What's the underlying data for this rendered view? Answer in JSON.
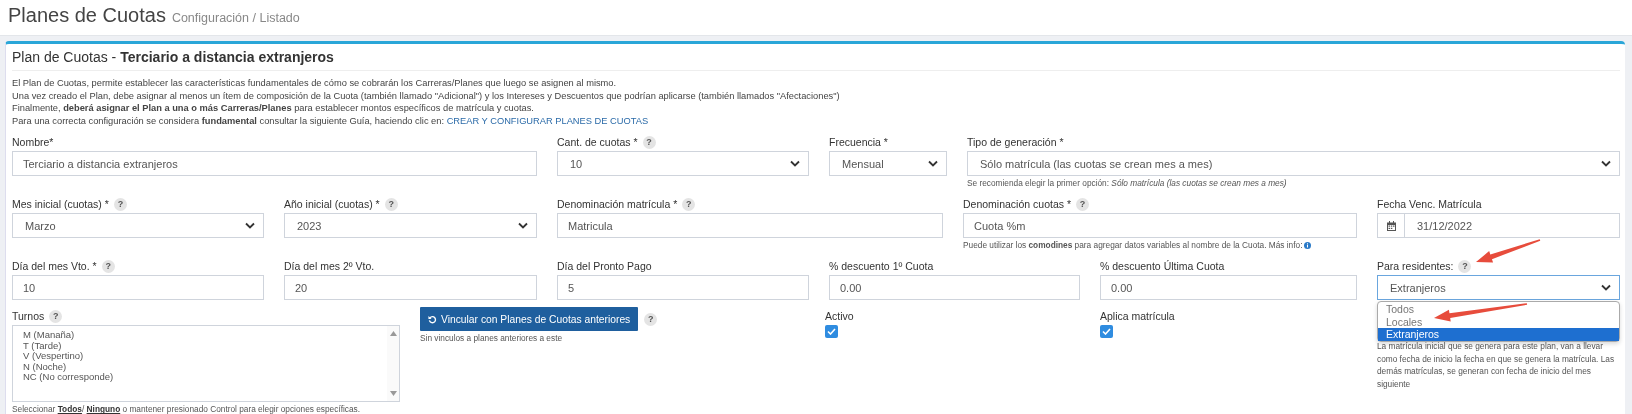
{
  "header": {
    "title": "Planes de Cuotas",
    "breadcrumb": "Configuración / Listado"
  },
  "card": {
    "title": "Plan de Cuotas - **Terciario a distancia extranjeros**",
    "description": [
      {
        "text": "El Plan de Cuotas, permite establecer las características fundamentales de cómo se cobrarán los Carreras/Planes que luego se asignen al mismo."
      },
      {
        "text": "Una vez creado el Plan, debe asignar al menos un ítem de composición de la Cuota (también llamado \"Adicional\") y los Intereses y Descuentos que podrían aplicarse (también llamados \"Afectaciones\")"
      },
      {
        "text": "Finalmente, **deberá asignar el Plan a una o más Carreras/Planes** para establecer montos específicos de matrícula y cuotas."
      },
      {
        "text": "Para una correcta configuración se considera **fundamental** consultar la siguiente Guía, haciendo clic en:",
        "link": "CREAR Y CONFIGURAR PLANES DE CUOTAS"
      }
    ],
    "fields": [
      {
        "kind": "text",
        "label": "Nombre*",
        "value": "Terciario a distancia extranjeros"
      },
      {
        "kind": "select",
        "label": "Cant. de cuotas *",
        "help": "?",
        "value": "10"
      },
      {
        "kind": "select",
        "label": "Frecuencia *",
        "value": "Mensual"
      },
      {
        "kind": "select",
        "label": "Tipo de generación *",
        "value": "Sólo matrícula (las cuotas se crean mes a mes)",
        "hint": "Se recomienda elegir la primer opción: *Sólo matrícula (las cuotas se crean mes a mes)*"
      },
      {
        "kind": "select",
        "label": "Mes inicial (cuotas) *",
        "help": "?",
        "value": "Marzo"
      },
      {
        "kind": "select",
        "label": "Año inicial (cuotas) *",
        "help": "?",
        "value": "2023"
      },
      {
        "kind": "text",
        "label": "Denominación matrícula *",
        "help": "?",
        "value": "Matricula"
      },
      {
        "kind": "text",
        "label": "Denominación cuotas *",
        "help": "?",
        "value": "Cuota %m",
        "hint": "Puede utilizar los **comodines** para agregar datos variables al nombre de la Cuota. Más info:",
        "hint_info": true
      },
      {
        "kind": "date",
        "label": "Fecha Venc. Matrícula",
        "value": "31/12/2022"
      },
      {
        "kind": "text",
        "label": "Día del mes Vto. *",
        "help": "?",
        "value": "10"
      },
      {
        "kind": "text",
        "label": "Día del mes 2º Vto.",
        "value": "20"
      },
      {
        "kind": "text",
        "label": "Día del Pronto Pago",
        "value": "5"
      },
      {
        "kind": "text",
        "label": "% descuento 1º Cuota",
        "value": "0.00"
      },
      {
        "kind": "text",
        "label": "% descuento Última Cuota",
        "value": "0.00"
      },
      {
        "kind": "select",
        "label": "Para residentes:",
        "help": "?",
        "value": "Extranjeros",
        "open": true,
        "options": [
          {
            "label": "Todos",
            "selected": false
          },
          {
            "label": "Locales",
            "selected": false
          },
          {
            "label": "Extranjeros",
            "selected": true
          }
        ]
      },
      {
        "kind": "listbox",
        "label": "Turnos",
        "help": "?",
        "options": [
          "M (Manaña)",
          "T (Tarde)",
          "V (Vespertino)",
          "N (Noche)",
          "NC (No corresponde)"
        ],
        "hint_parts": [
          {
            "text": "Seleccionar "
          },
          {
            "link": "Todos"
          },
          {
            "text": "/ "
          },
          {
            "link": "Ninguno"
          },
          {
            "text": " o mantener presionado Control para elegir opciones específicas."
          }
        ]
      },
      {
        "kind": "button",
        "label": "Vincular con Planes de Cuotas anteriores",
        "help": "?",
        "hint": "Sin vinculos a planes anteriores a este"
      },
      {
        "kind": "checkbox",
        "label": "Activo",
        "checked": true
      },
      {
        "kind": "checkbox",
        "label": "Aplica matrícula",
        "checked": true
      },
      {
        "kind": "note",
        "text": "La matrícula inicial que se genera para este plan, van a llevar como fecha de inicio la fecha en que se genera la matrícula. Las demás matrículas, se generan con fecha de inicio del mes siguiente"
      }
    ]
  }
}
